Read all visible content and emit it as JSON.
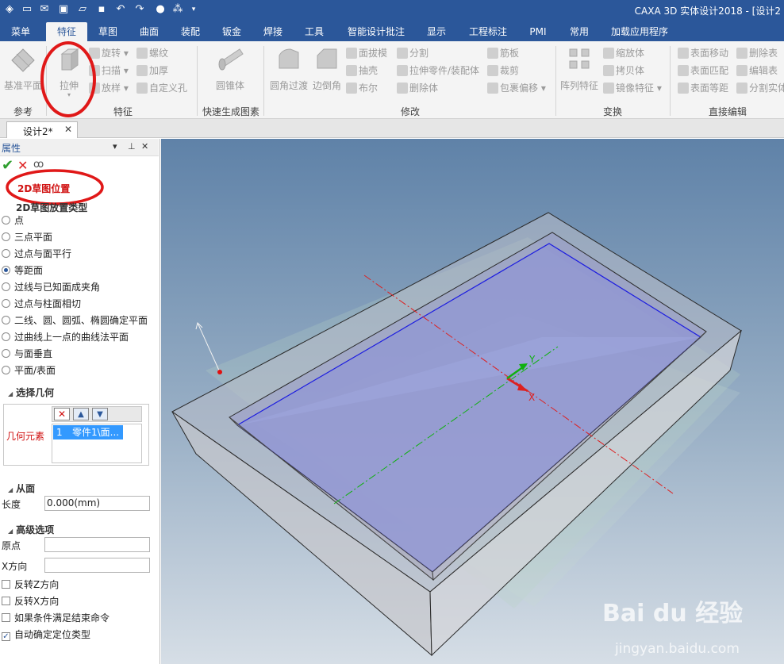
{
  "window": {
    "title": "CAXA 3D 实体设计2018 - [设计2"
  },
  "menu": {
    "tabs": [
      "菜单",
      "特征",
      "草图",
      "曲面",
      "装配",
      "钣金",
      "焊接",
      "工具",
      "智能设计批注",
      "显示",
      "工程标注",
      "PMI",
      "常用",
      "加载应用程序"
    ],
    "active": "特征"
  },
  "ribbon": {
    "groups": [
      "参考",
      "特征",
      "快速生成图素",
      "修改",
      "变换",
      "直接编辑"
    ],
    "buttons": {
      "base_plane": "基准平面",
      "extrude": "拉伸",
      "revolve": "旋转",
      "sweep": "扫描",
      "loft": "放样",
      "thread": "螺纹",
      "thicken": "加厚",
      "custom_hole": "自定义孔",
      "cone": "圆锥体",
      "fillet": "圆角过渡",
      "chamfer": "边倒角",
      "draft": "面拔模",
      "shell": "抽壳",
      "boolean": "布尔",
      "split": "分割",
      "extrude_part": "拉伸零件/装配体",
      "delete_body": "删除体",
      "rib": "筋板",
      "trim": "裁剪",
      "wrap": "包裹偏移",
      "pattern": "阵列特征",
      "scale_body": "缩放体",
      "copy_body": "拷贝体",
      "mirror": "镜像特征",
      "face_move": "表面移动",
      "face_match": "表面匹配",
      "face_offset": "表面等距",
      "delete_face": "删除表",
      "edit_face": "编辑表",
      "split_solid": "分割实体"
    }
  },
  "document": {
    "tab_label": "设计2*",
    "close": "✕"
  },
  "panel": {
    "header": "属性",
    "title": "2D草图位置",
    "section_type": "2D草图放置类型",
    "options": [
      "点",
      "三点平面",
      "过点与面平行",
      "等距面",
      "过线与已知面成夹角",
      "过点与柱面相切",
      "二线、圆、圆弧、椭圆确定平面",
      "过曲线上一点的曲线法平面",
      "与面垂直",
      "平面/表面"
    ],
    "selected_option": "等距面",
    "section_geometry": "选择几何",
    "geometry_label": "几何元素",
    "geometry_items": [
      {
        "index": "1",
        "name": "零件1\\面..."
      }
    ],
    "section_from": "从面",
    "length_label": "长度",
    "length_value": "0.000(mm)",
    "section_advanced": "高级选项",
    "origin_label": "原点",
    "xdir_label": "X方向",
    "checkboxes": [
      {
        "label": "反转Z方向",
        "checked": false
      },
      {
        "label": "反转X方向",
        "checked": false
      },
      {
        "label": "如果条件满足结束命令",
        "checked": false
      },
      {
        "label": "自动确定定位类型",
        "checked": true
      }
    ]
  },
  "viewport": {
    "axis_x": "X",
    "axis_y": "Y"
  },
  "watermark": {
    "brand": "Bai du 经验",
    "url": "jingyan.baidu.com"
  }
}
